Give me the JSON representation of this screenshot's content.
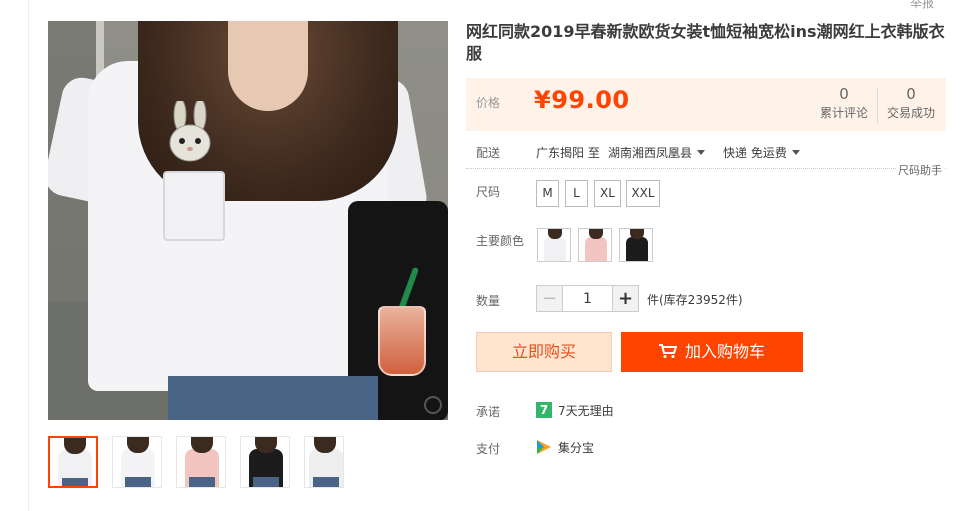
{
  "top": {
    "report": "举报"
  },
  "product": {
    "title": "网红同款2019早春新款欧货女装t恤短袖宽松ins潮网红上衣韩版衣服"
  },
  "price": {
    "label": "价格",
    "value": "¥99.00",
    "reviews_count": "0",
    "reviews_label": "累计评论",
    "trades_count": "0",
    "trades_label": "交易成功"
  },
  "shipping": {
    "label": "配送",
    "from": "广东揭阳 至",
    "to": "湖南湘西凤凰县",
    "method": "快递 免运费"
  },
  "size": {
    "label": "尺码",
    "helper": "尺码助手",
    "options": [
      "M",
      "L",
      "XL",
      "XXL"
    ]
  },
  "color": {
    "label": "主要颜色"
  },
  "quantity": {
    "label": "数量",
    "minus": "−",
    "plus": "+",
    "value": "1",
    "stock": "件(库存23952件)"
  },
  "actions": {
    "buy_now": "立即购买",
    "add_to_cart": "加入购物车"
  },
  "promise": {
    "label": "承诺",
    "badge": "7",
    "text": "7天无理由"
  },
  "payment": {
    "label": "支付",
    "text": "集分宝"
  },
  "colors": {
    "accent": "#ff4400",
    "price_bg": "#fff2e8",
    "buy_bg": "#ffe4d0"
  }
}
